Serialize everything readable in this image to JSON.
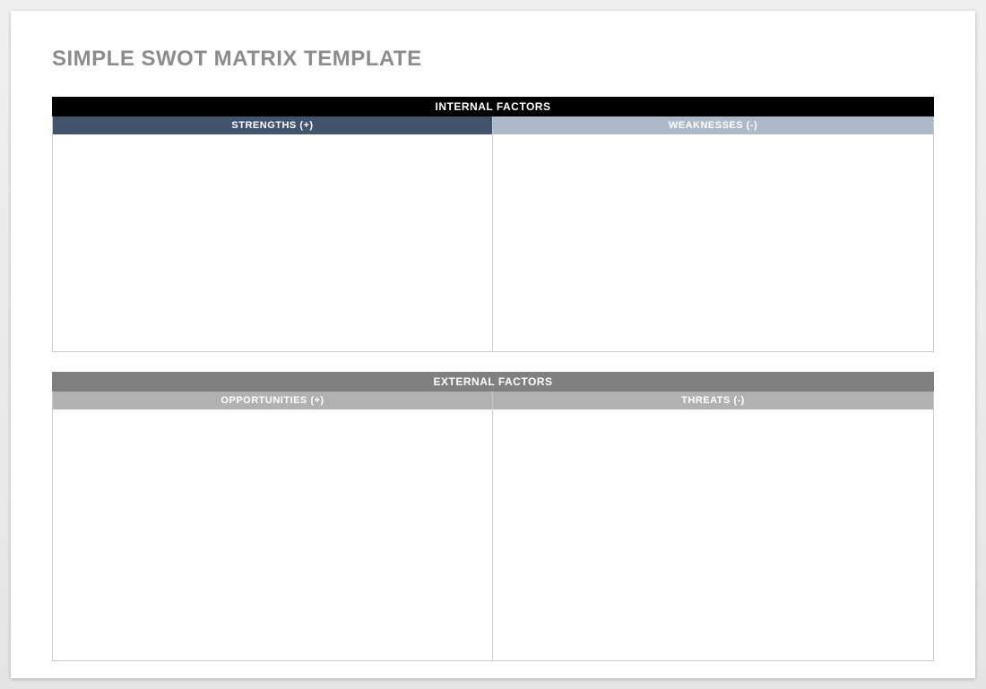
{
  "title": "SIMPLE SWOT MATRIX TEMPLATE",
  "sections": {
    "internal": {
      "label": "INTERNAL FACTORS",
      "left_label": "STRENGTHS (+)",
      "right_label": "WEAKNESSES (-)",
      "left_content": "",
      "right_content": ""
    },
    "external": {
      "label": "EXTERNAL FACTORS",
      "left_label": "OPPORTUNITIES (+)",
      "right_label": "THREATS (-)",
      "left_content": "",
      "right_content": ""
    }
  },
  "colors": {
    "title_text": "#8c8c8c",
    "internal_header_bg": "#000000",
    "external_header_bg": "#808080",
    "strengths_bg": "#41536d",
    "weaknesses_bg": "#adb8c9",
    "opportunities_bg": "#b1b1b1",
    "threats_bg": "#b1b1b1",
    "border": "#cccccc"
  }
}
